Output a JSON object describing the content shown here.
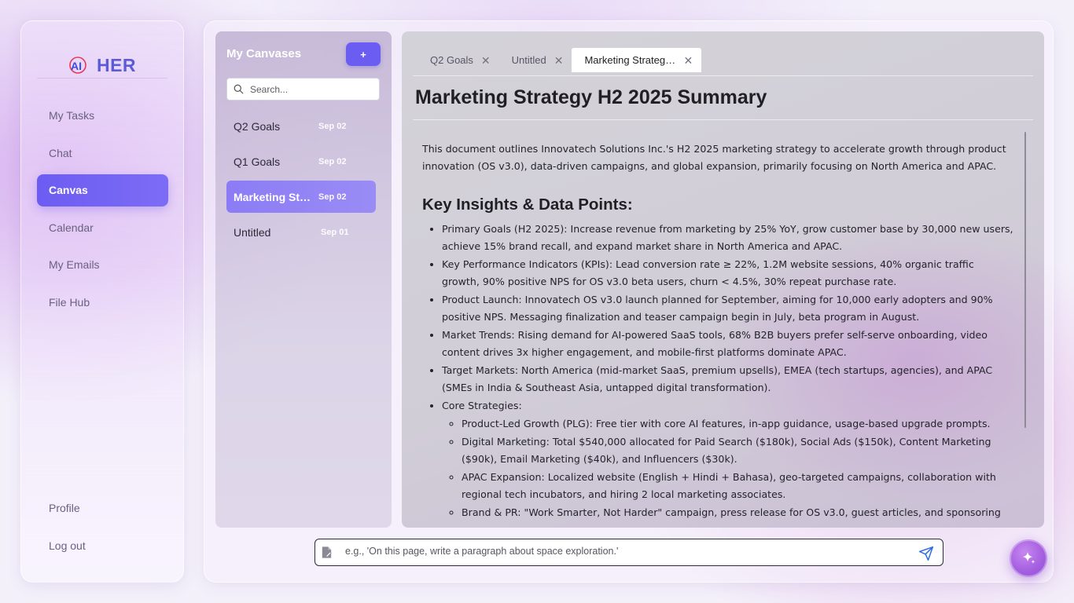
{
  "brand": {
    "logo_text": "AI",
    "name": "HER"
  },
  "nav": {
    "items": [
      {
        "label": "My Tasks"
      },
      {
        "label": "Chat"
      },
      {
        "label": "Canvas",
        "active": true
      },
      {
        "label": "Calendar"
      },
      {
        "label": "My Emails"
      },
      {
        "label": "File Hub"
      }
    ],
    "bottom": [
      {
        "label": "Profile"
      },
      {
        "label": "Log out"
      }
    ]
  },
  "canvases": {
    "title": "My Canvases",
    "add_label": "+",
    "search_placeholder": "Search...",
    "items": [
      {
        "title": "Q2 Goals",
        "date": "Sep 02"
      },
      {
        "title": "Q1 Goals",
        "date": "Sep 02"
      },
      {
        "title": "Marketing Strategy H2 2025 Summary",
        "date": "Sep 02",
        "active": true
      },
      {
        "title": "Untitled",
        "date": "Sep 01"
      }
    ]
  },
  "tabs": [
    {
      "label": "Q2 Goals"
    },
    {
      "label": "Untitled"
    },
    {
      "label": "Marketing Strategy H2 2025 Summary",
      "active": true
    }
  ],
  "document": {
    "title": "Marketing Strategy H2 2025 Summary",
    "intro": "This document outlines Innovatech Solutions Inc.'s H2 2025 marketing strategy to accelerate growth through product innovation (OS v3.0), data-driven campaigns, and global expansion, primarily focusing on North America and APAC.",
    "section_heading": "Key Insights & Data Points:",
    "bullets": [
      "Primary Goals (H2 2025): Increase revenue from marketing by 25% YoY, grow customer base by 30,000 new users, achieve 15% brand recall, and expand market share in North America and APAC.",
      "Key Performance Indicators (KPIs): Lead conversion rate ≥ 22%, 1.2M website sessions, 40% organic traffic growth, 90% positive NPS for OS v3.0 beta users, churn < 4.5%, 30% repeat purchase rate.",
      "Product Launch: Innovatech OS v3.0 launch planned for September, aiming for 10,000 early adopters and 90% positive NPS. Messaging finalization and teaser campaign begin in July, beta program in August.",
      "Market Trends: Rising demand for AI-powered SaaS tools, 68% B2B buyers prefer self-serve onboarding, video content drives 3x higher engagement, and mobile-first platforms dominate APAC.",
      "Target Markets: North America (mid-market SaaS, premium upsells), EMEA (tech startups, agencies), and APAC (SMEs in India & Southeast Asia, untapped digital transformation).",
      "Core Strategies:"
    ],
    "sub_bullets": [
      "Product-Led Growth (PLG): Free tier with core AI features, in-app guidance, usage-based upgrade prompts.",
      "Digital Marketing: Total $540,000 allocated for Paid Search ($180k), Social Ads ($150k), Content Marketing ($90k), Email Marketing ($40k), and Influencers ($30k).",
      "APAC Expansion: Localized website (English + Hindi + Bahasa), geo-targeted campaigns, collaboration with regional tech incubators, and hiring 2 local marketing associates.",
      "Brand & PR: \"Work Smarter, Not Harder\" campaign, press release for OS v3.0, guest articles, and sponsoring"
    ]
  },
  "prompt": {
    "placeholder": "e.g., 'On this page, write a paragraph about space exploration.'"
  },
  "icons": {
    "brand_logo": "ai-logo-icon",
    "search": "search-icon",
    "close": "close-icon",
    "document": "document-icon",
    "send": "send-icon",
    "assistant": "sparkle-icon"
  },
  "colors": {
    "accent": "#6d5cf2",
    "brand": "#5b5bd6",
    "active_canvas": "#8b7cf5"
  }
}
